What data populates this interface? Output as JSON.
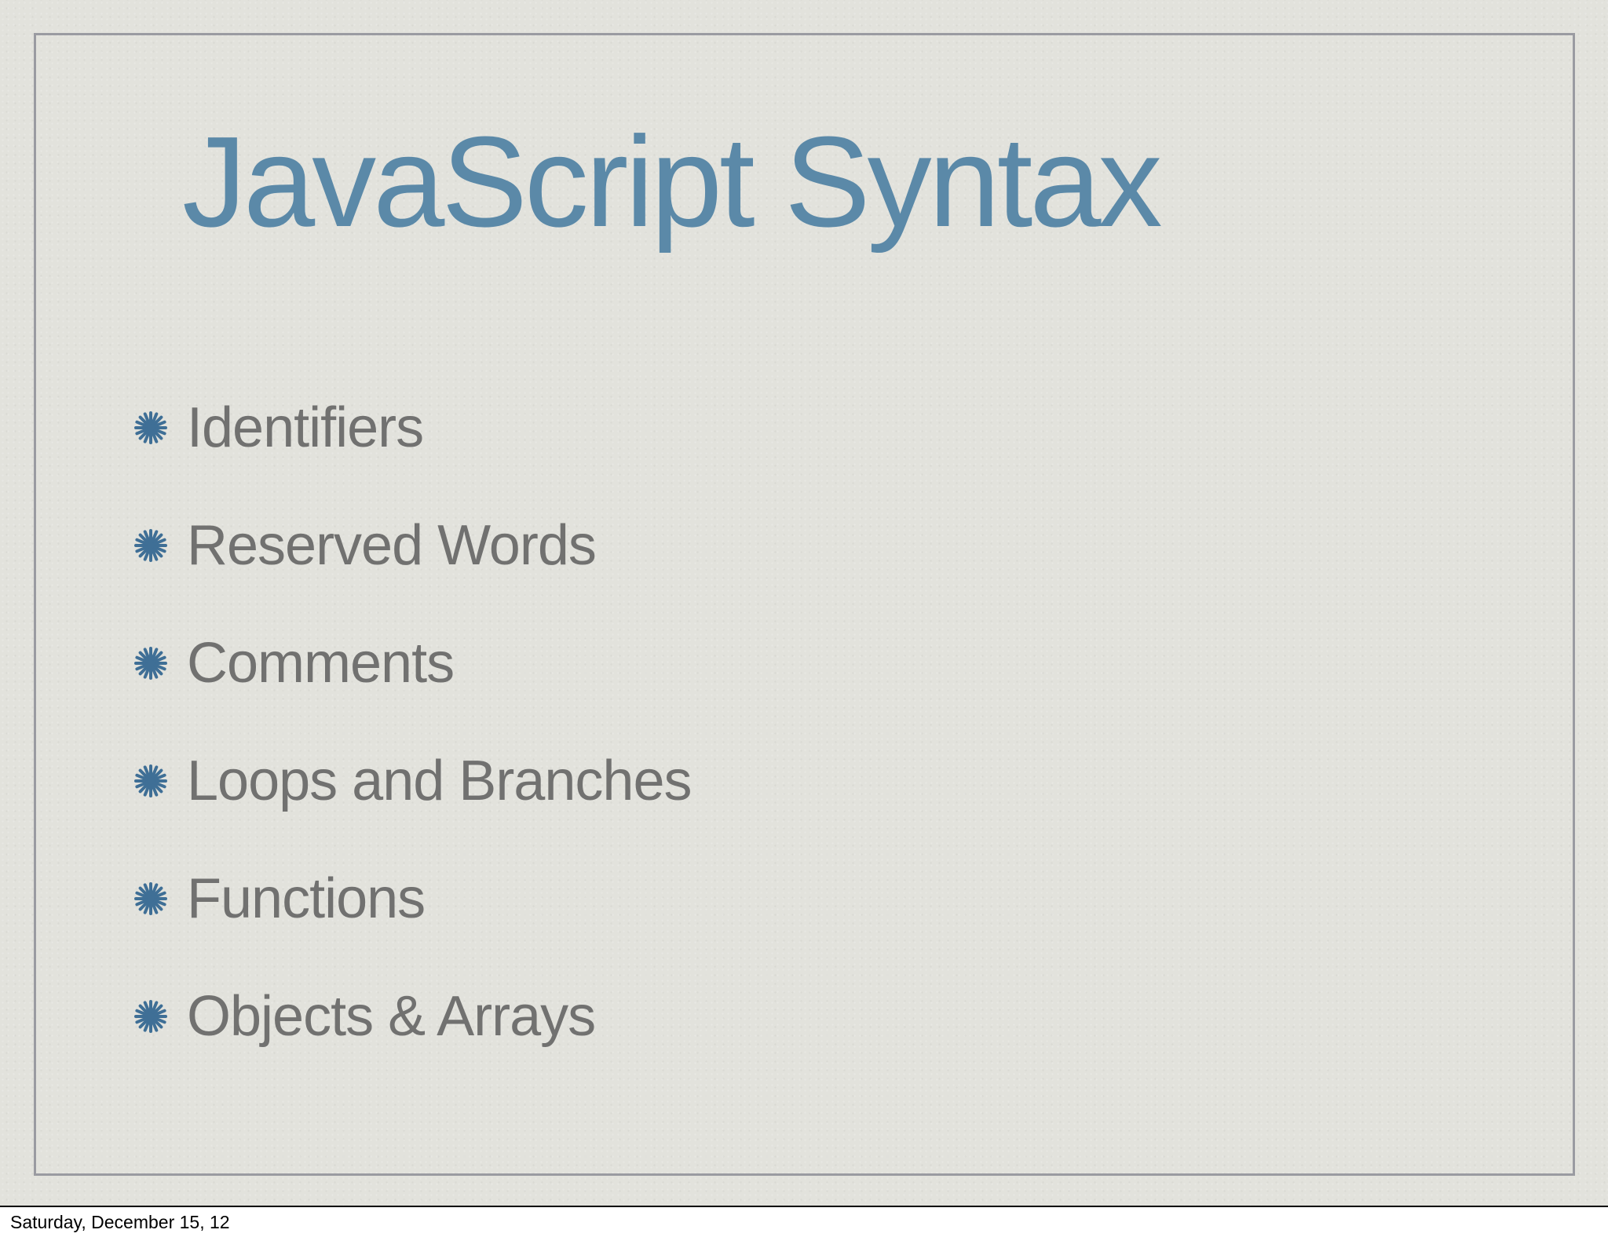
{
  "slide": {
    "title": "JavaScript Syntax",
    "bullet_icon": "asterisk-bullet-icon",
    "bullet_color": "#3f6f96",
    "title_color": "#5b89a8",
    "text_color": "#717170",
    "bullets": [
      {
        "label": "Identifiers"
      },
      {
        "label": "Reserved Words"
      },
      {
        "label": "Comments"
      },
      {
        "label": "Loops and Branches"
      },
      {
        "label": "Functions"
      },
      {
        "label": "Objects & Arrays"
      }
    ]
  },
  "footer": {
    "date": "Saturday, December 15, 12"
  }
}
